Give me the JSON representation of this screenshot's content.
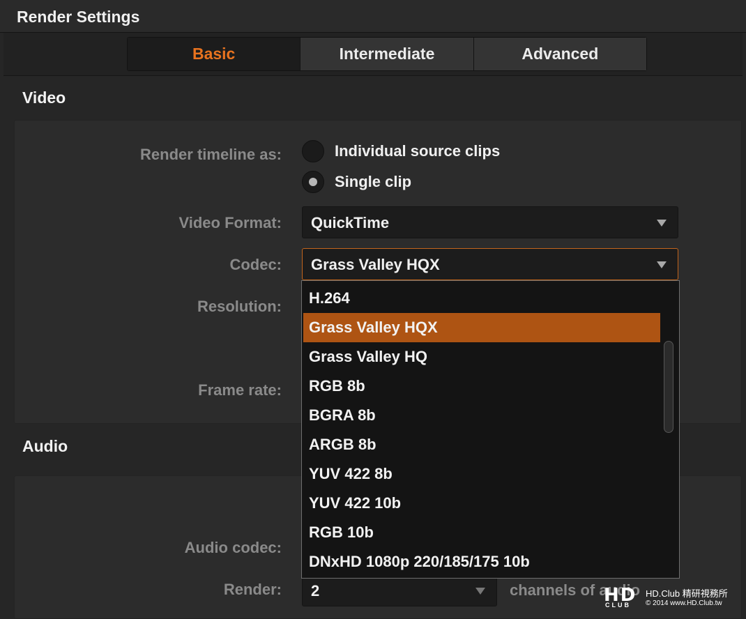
{
  "window": {
    "title": "Render Settings"
  },
  "tabs": [
    {
      "label": "Basic",
      "active": true
    },
    {
      "label": "Intermediate",
      "active": false
    },
    {
      "label": "Advanced",
      "active": false
    }
  ],
  "video": {
    "section_title": "Video",
    "render_timeline_label": "Render timeline as:",
    "render_options": [
      {
        "label": "Individual source clips",
        "selected": false
      },
      {
        "label": "Single clip",
        "selected": true
      }
    ],
    "video_format_label": "Video Format:",
    "video_format_value": "QuickTime",
    "codec_label": "Codec:",
    "codec_value": "Grass Valley HQX",
    "resolution_label": "Resolution:",
    "frame_rate_label": "Frame rate:"
  },
  "codec_dropdown": {
    "options": [
      "H.264",
      "Grass Valley HQX",
      "Grass Valley HQ",
      "RGB 8b",
      "BGRA 8b",
      "ARGB 8b",
      "YUV 422 8b",
      "YUV 422 10b",
      "RGB 10b",
      "DNxHD 1080p 220/185/175 10b"
    ],
    "selected": "Grass Valley HQX"
  },
  "audio": {
    "section_title": "Audio",
    "audio_codec_label": "Audio codec:",
    "render_label": "Render:",
    "render_channels_value": "2",
    "channels_text": "channels of audio"
  },
  "watermark": {
    "logo_text": "HD",
    "logo_sub": "CLUB",
    "line1": "HD.Club 精研視務所",
    "line2": "© 2014  www.HD.Club.tw"
  },
  "colors": {
    "accent": "#e8731f",
    "selection": "#ae5413",
    "focus_border": "#c2651c"
  }
}
